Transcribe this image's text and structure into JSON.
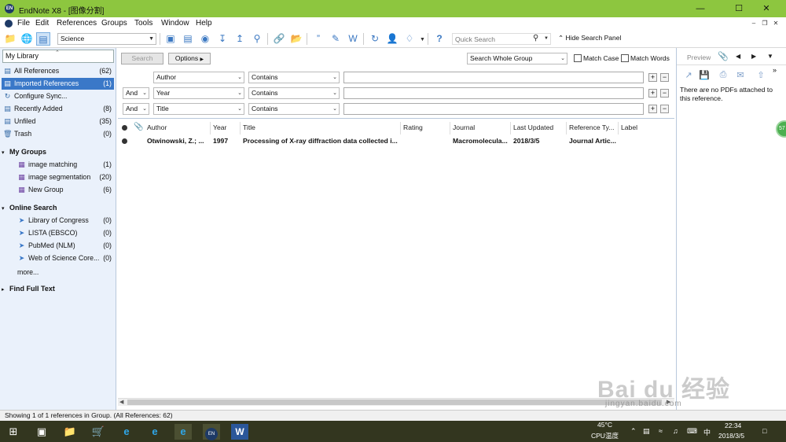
{
  "window": {
    "title": "EndNote X8 - [图像分割]",
    "app_icon_text": "EN"
  },
  "menu": [
    "File",
    "Edit",
    "References",
    "Groups",
    "Tools",
    "Window",
    "Help"
  ],
  "toolbar": {
    "style_value": "Science",
    "quick_search_placeholder": "Quick Search",
    "hide_search_label": "Hide Search Panel"
  },
  "library": {
    "title": "My Library",
    "items": [
      {
        "label": "All References",
        "count": "(62)"
      },
      {
        "label": "Imported References",
        "count": "(1)"
      },
      {
        "label": "Configure Sync...",
        "count": ""
      },
      {
        "label": "Recently Added",
        "count": "(8)"
      },
      {
        "label": "Unfiled",
        "count": "(35)"
      },
      {
        "label": "Trash",
        "count": "(0)"
      }
    ],
    "my_groups_label": "My Groups",
    "groups": [
      {
        "label": "image matching",
        "count": "(1)"
      },
      {
        "label": "image segmentation",
        "count": "(20)"
      },
      {
        "label": "New Group",
        "count": "(6)"
      }
    ],
    "online_search_label": "Online Search",
    "online": [
      {
        "label": "Library of Congress",
        "count": "(0)"
      },
      {
        "label": "LISTA (EBSCO)",
        "count": "(0)"
      },
      {
        "label": "PubMed (NLM)",
        "count": "(0)"
      },
      {
        "label": "Web of Science Core...",
        "count": "(0)"
      }
    ],
    "more_label": "more...",
    "find_full_text_label": "Find Full Text"
  },
  "search": {
    "search_button": "Search",
    "options_button": "Options",
    "scope": "Search Whole Group",
    "match_case": "Match Case",
    "match_words": "Match Words",
    "rows": [
      {
        "bool": "",
        "field": "Author",
        "op": "Contains",
        "value": ""
      },
      {
        "bool": "And",
        "field": "Year",
        "op": "Contains",
        "value": ""
      },
      {
        "bool": "And",
        "field": "Title",
        "op": "Contains",
        "value": ""
      }
    ]
  },
  "reflist": {
    "columns": [
      "Author",
      "Year",
      "Title",
      "Rating",
      "Journal",
      "Last Updated",
      "Reference Ty...",
      "Label"
    ],
    "rows": [
      {
        "author": "Otwinowski, Z.; ...",
        "year": "1997",
        "title": "Processing of X-ray diffraction data collected i...",
        "rating": "",
        "journal": "Macromolecula...",
        "updated": "2018/3/5",
        "reftype": "Journal Artic...",
        "label": ""
      }
    ]
  },
  "preview": {
    "tab_label": "Preview",
    "message": "There are no PDFs attached to this reference."
  },
  "statusbar": {
    "text": "Showing 1 of 1 references in Group. (All References: 62)"
  },
  "taskbar": {
    "temp": "45°C",
    "temp_label": "CPU温度",
    "ime": "中",
    "time": "22:34",
    "date": "2018/3/5",
    "endnote_btn": "EN"
  },
  "side_badge": "57",
  "watermark": {
    "line1": "Bai du 经验",
    "line2": "jingyan.baidu.com"
  },
  "colors": {
    "titlebar": "#8dc63f",
    "selection": "#3a78c8",
    "leftpanel": "#eaf1fb",
    "taskbar": "#33361f"
  }
}
